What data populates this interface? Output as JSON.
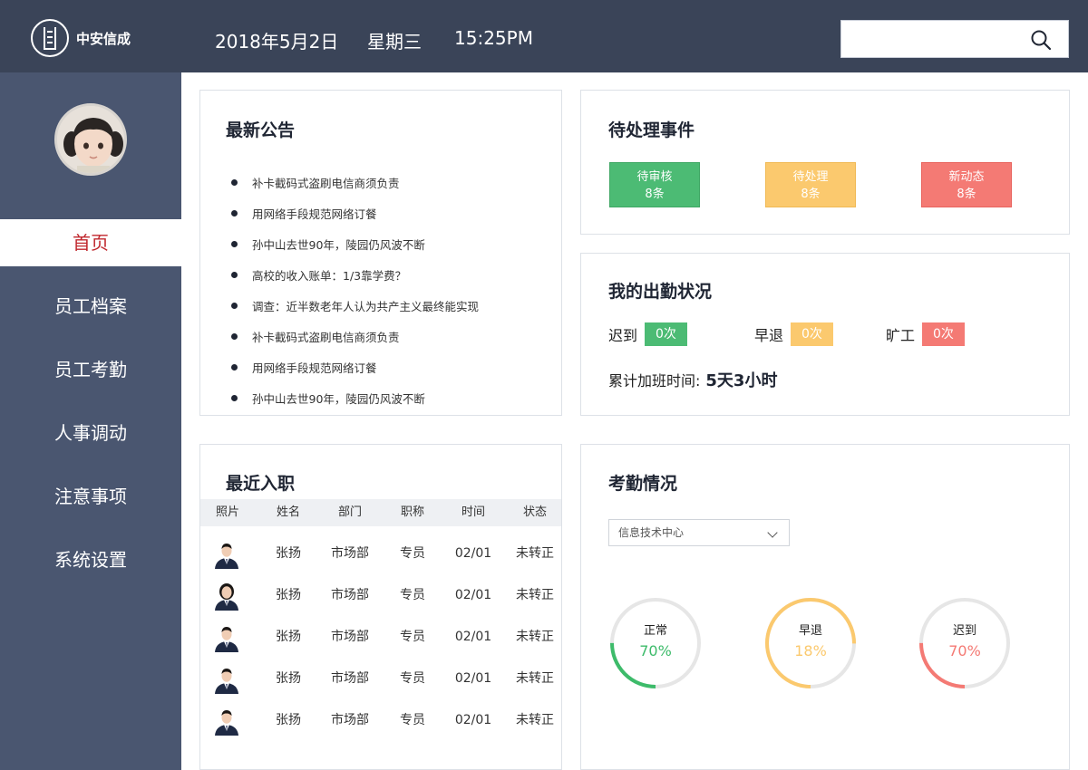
{
  "header": {
    "brand": "中安信成",
    "date": "2018年5月2日",
    "weekday": "星期三",
    "time": "15:25PM",
    "search_value": ""
  },
  "sidebar": {
    "items": [
      {
        "label": "首页",
        "active": true
      },
      {
        "label": "员工档案"
      },
      {
        "label": "员工考勤"
      },
      {
        "label": "人事调动"
      },
      {
        "label": "注意事项"
      },
      {
        "label": "系统设置"
      }
    ]
  },
  "notices": {
    "title": "最新公告",
    "items": [
      "补卡截码式盗刷电信商须负责",
      "用网络手段规范网络订餐",
      "孙中山去世90年，陵园仍风波不断",
      "高校的收入账单：1/3靠学费？",
      "调查：近半数老年人认为共产主义最终能实现",
      "补卡截码式盗刷电信商须负责",
      "用网络手段规范网络订餐",
      "孙中山去世90年，陵园仍风波不断"
    ]
  },
  "pending": {
    "title": "待处理事件",
    "items": [
      {
        "label": "待审核",
        "count": "8条",
        "color": "#4cbb74"
      },
      {
        "label": "待处理",
        "count": "8条",
        "color": "#fbc96e"
      },
      {
        "label": "新动态",
        "count": "8条",
        "color": "#f47a74"
      }
    ]
  },
  "attendance_me": {
    "title": "我的出勤状况",
    "late_label": "迟到",
    "late_value": "0次",
    "early_label": "早退",
    "early_value": "0次",
    "absent_label": "旷工",
    "absent_value": "0次",
    "overtime_label": "累计加班时间:",
    "overtime_value": "5天3小时"
  },
  "hires": {
    "title": "最近入职",
    "columns": [
      "照片",
      "姓名",
      "部门",
      "职称",
      "时间",
      "状态"
    ],
    "rows": [
      {
        "gender": "male",
        "name": "张扬",
        "dept": "市场部",
        "title": "专员",
        "date": "02/01",
        "status": "未转正"
      },
      {
        "gender": "female",
        "name": "张扬",
        "dept": "市场部",
        "title": "专员",
        "date": "02/01",
        "status": "未转正"
      },
      {
        "gender": "male",
        "name": "张扬",
        "dept": "市场部",
        "title": "专员",
        "date": "02/01",
        "status": "未转正"
      },
      {
        "gender": "male",
        "name": "张扬",
        "dept": "市场部",
        "title": "专员",
        "date": "02/01",
        "status": "未转正"
      },
      {
        "gender": "male",
        "name": "张扬",
        "dept": "市场部",
        "title": "专员",
        "date": "02/01",
        "status": "未转正"
      }
    ]
  },
  "stats": {
    "title": "考勤情况",
    "department": "信息技术中心",
    "rings": [
      {
        "label": "正常",
        "value": "70%",
        "fraction": 0.25,
        "color": "#3dbb6a"
      },
      {
        "label": "早退",
        "value": "18%",
        "fraction": 0.75,
        "color": "#fbc96e"
      },
      {
        "label": "迟到",
        "value": "70%",
        "fraction": 0.25,
        "color": "#f47a74"
      }
    ],
    "track_color": "#e6e6e6"
  }
}
